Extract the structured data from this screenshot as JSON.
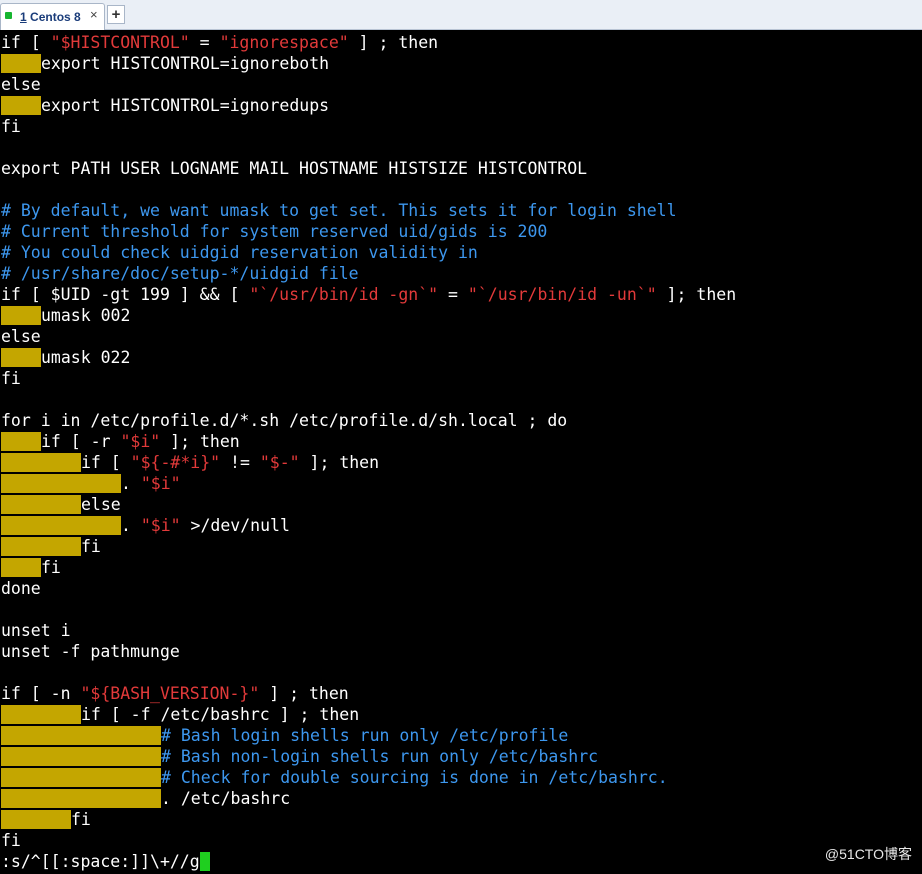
{
  "window": {
    "tab": {
      "number": "1",
      "title": "Centos 8",
      "close": "×"
    },
    "new_tab": "+"
  },
  "terminal": {
    "lines": [
      [
        [
          "t",
          "if [ "
        ],
        [
          "s",
          "\"$HISTCONTROL\""
        ],
        [
          "t",
          " = "
        ],
        [
          "s",
          "\"ignorespace\""
        ],
        [
          "t",
          " ] ; then"
        ]
      ],
      [
        [
          "i",
          1
        ],
        [
          "t",
          "export HISTCONTROL=ignoreboth"
        ]
      ],
      [
        [
          "t",
          "else"
        ]
      ],
      [
        [
          "i",
          1
        ],
        [
          "t",
          "export HISTCONTROL=ignoredups"
        ]
      ],
      [
        [
          "t",
          "fi"
        ]
      ],
      [],
      [
        [
          "t",
          "export PATH USER LOGNAME MAIL HOSTNAME HISTSIZE HISTCONTROL"
        ]
      ],
      [],
      [
        [
          "c",
          "# By default, we want umask to get set. This sets it for login shell"
        ]
      ],
      [
        [
          "c",
          "# Current threshold for system reserved uid/gids is 200"
        ]
      ],
      [
        [
          "c",
          "# You could check uidgid reservation validity in"
        ]
      ],
      [
        [
          "c",
          "# /usr/share/doc/setup-*/uidgid file"
        ]
      ],
      [
        [
          "t",
          "if [ $UID -gt 199 ] && [ "
        ],
        [
          "s",
          "\"`/usr/bin/id -gn`\""
        ],
        [
          "t",
          " = "
        ],
        [
          "s",
          "\"`/usr/bin/id -un`\""
        ],
        [
          "t",
          " ]; then"
        ]
      ],
      [
        [
          "i",
          1
        ],
        [
          "t",
          "umask 002"
        ]
      ],
      [
        [
          "t",
          "else"
        ]
      ],
      [
        [
          "i",
          1
        ],
        [
          "t",
          "umask 022"
        ]
      ],
      [
        [
          "t",
          "fi"
        ]
      ],
      [],
      [
        [
          "t",
          "for i in /etc/profile.d/*.sh /etc/profile.d/sh.local ; do"
        ]
      ],
      [
        [
          "i",
          1
        ],
        [
          "t",
          "if [ -r "
        ],
        [
          "s",
          "\"$i\""
        ],
        [
          "t",
          " ]; then"
        ]
      ],
      [
        [
          "i",
          2
        ],
        [
          "t",
          "if [ "
        ],
        [
          "s",
          "\"${-#*i}\""
        ],
        [
          "t",
          " != "
        ],
        [
          "s",
          "\"$-\""
        ],
        [
          "t",
          " ]; then"
        ]
      ],
      [
        [
          "i",
          3
        ],
        [
          "t",
          ". "
        ],
        [
          "s",
          "\"$i\""
        ]
      ],
      [
        [
          "i",
          2
        ],
        [
          "t",
          "else"
        ]
      ],
      [
        [
          "i",
          3
        ],
        [
          "t",
          ". "
        ],
        [
          "s",
          "\"$i\""
        ],
        [
          "t",
          " >/dev/null"
        ]
      ],
      [
        [
          "i",
          2
        ],
        [
          "t",
          "fi"
        ]
      ],
      [
        [
          "i",
          1
        ],
        [
          "t",
          "fi"
        ]
      ],
      [
        [
          "t",
          "done"
        ]
      ],
      [],
      [
        [
          "t",
          "unset i"
        ]
      ],
      [
        [
          "t",
          "unset -f pathmunge"
        ]
      ],
      [],
      [
        [
          "t",
          "if [ -n "
        ],
        [
          "s",
          "\"${BASH_VERSION-}\""
        ],
        [
          "t",
          " ] ; then"
        ]
      ],
      [
        [
          "i",
          2
        ],
        [
          "t",
          "if [ -f /etc/bashrc ] ; then"
        ]
      ],
      [
        [
          "i",
          4
        ],
        [
          "c",
          "# Bash login shells run only /etc/profile"
        ]
      ],
      [
        [
          "i",
          4
        ],
        [
          "c",
          "# Bash non-login shells run only /etc/bashrc"
        ]
      ],
      [
        [
          "i",
          4
        ],
        [
          "c",
          "# Check for double sourcing is done in /etc/bashrc."
        ]
      ],
      [
        [
          "i",
          4
        ],
        [
          "t",
          ". /etc/bashrc"
        ]
      ],
      [
        [
          "i",
          1.75
        ],
        [
          "t",
          "fi"
        ]
      ],
      [
        [
          "t",
          "fi"
        ]
      ],
      [
        [
          "t",
          ":s/^[[:space:]]\\+//g"
        ],
        [
          "cur",
          ""
        ]
      ]
    ]
  },
  "watermark": "@51CTO博客",
  "colors": {
    "background": "#000000",
    "text": "#ffffff",
    "string": "#e23a3a",
    "comment": "#3d97ee",
    "indent_highlight": "#c4a600",
    "cursor": "#1fcf1f",
    "tab_status": "#17b530"
  }
}
